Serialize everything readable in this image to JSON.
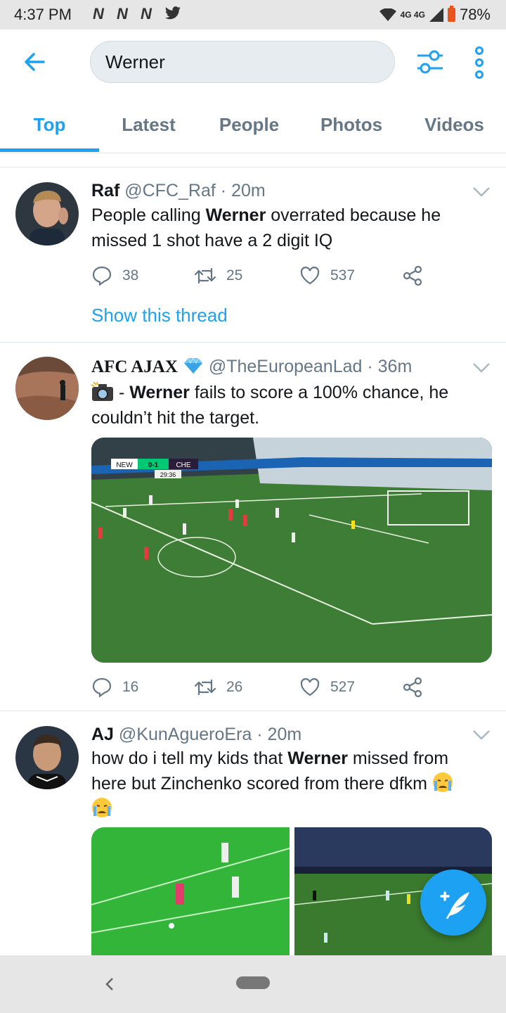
{
  "status_bar": {
    "time": "4:37 PM",
    "notifications": "N N N",
    "network": "4G 4G",
    "battery": "78%"
  },
  "search": {
    "query": "Werner"
  },
  "tabs": [
    {
      "label": "Top",
      "active": true
    },
    {
      "label": "Latest",
      "active": false
    },
    {
      "label": "People",
      "active": false
    },
    {
      "label": "Photos",
      "active": false
    },
    {
      "label": "Videos",
      "active": false
    }
  ],
  "accent_color": "#1da1f2",
  "tweets": [
    {
      "name": "Raf",
      "handle": "@CFC_Raf",
      "time": "20m",
      "text_before": "People calling ",
      "text_bold": "Werner",
      "text_after": " overrated because he missed 1 shot have a 2 digit IQ",
      "replies": "38",
      "retweets": "25",
      "likes": "537",
      "show_thread": "Show this thread"
    },
    {
      "name": "AFC AJAX",
      "verified_icon": "diamond-emoji",
      "handle": "@TheEuropeanLad",
      "time": "36m",
      "emoji": "camera-with-flash-emoji",
      "text_before": " - ",
      "text_bold": "Werner",
      "text_after": " fails to score a 100% chance, he couldn’t hit the target.",
      "media": {
        "scoreboard_home": "NEW",
        "scoreboard_score": "0-1",
        "scoreboard_away": "CHE",
        "clock": "29:36"
      },
      "replies": "16",
      "retweets": "26",
      "likes": "527"
    },
    {
      "name": "AJ",
      "handle": "@KunAgueroEra",
      "time": "20m",
      "text_before": "how do i tell my kids that ",
      "text_bold": "Werner",
      "text_after": " missed from here but Zinchenko scored from there dfkm ",
      "emoji": "crying-face-emoji"
    }
  ]
}
